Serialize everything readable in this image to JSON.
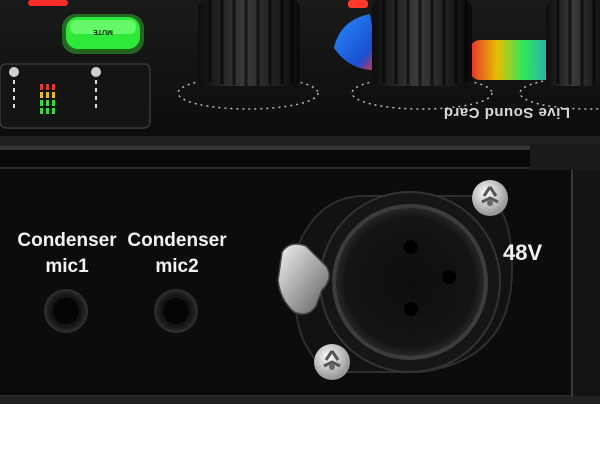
{
  "top_panel": {
    "brand_text": "Live Sound Card",
    "mute_label": "MUTE"
  },
  "front_panel": {
    "jacks": [
      {
        "line1": "Condenser",
        "line2": "mic1"
      },
      {
        "line1": "Condenser",
        "line2": "mic2"
      }
    ],
    "phantom_power_label": "48V"
  },
  "colors": {
    "panel": "#0c0c0c",
    "top_surface": "#161616",
    "mute_button": "#3cff3c",
    "led_green": "#38d84a",
    "led_yellow": "#e0c020",
    "led_red": "#e03a2a",
    "knob_glow_blue": "#1e7bff",
    "knob_glow_red": "#ff2a2a",
    "knob_glow_rainbow": "#ffd000"
  }
}
